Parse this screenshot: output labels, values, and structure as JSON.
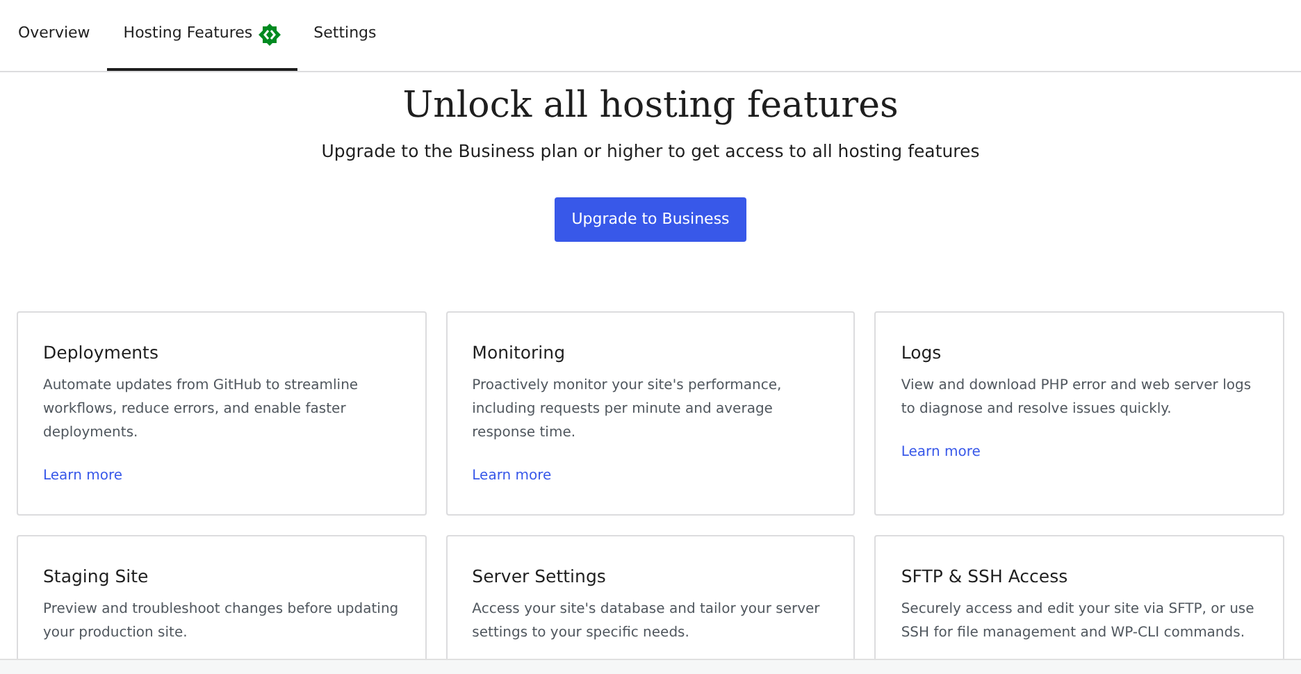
{
  "tabs": [
    {
      "label": "Overview",
      "selected": false,
      "badge": false
    },
    {
      "label": "Hosting Features",
      "selected": true,
      "badge": true
    },
    {
      "label": "Settings",
      "selected": false,
      "badge": false
    }
  ],
  "hero": {
    "title": "Unlock all hosting features",
    "subtitle": "Upgrade to the Business plan or higher to get access to all hosting features",
    "button": "Upgrade to Business"
  },
  "cards": [
    {
      "title": "Deployments",
      "description": "Automate updates from GitHub to streamline workflows, reduce errors, and enable faster deployments.",
      "link": "Learn more"
    },
    {
      "title": "Monitoring",
      "description": "Proactively monitor your site's performance, including requests per minute and average response time.",
      "link": "Learn more"
    },
    {
      "title": "Logs",
      "description": "View and download PHP error and web server logs to diagnose and resolve issues quickly.",
      "link": "Learn more"
    },
    {
      "title": "Staging Site",
      "description": "Preview and troubleshoot changes before updating your production site."
    },
    {
      "title": "Server Settings",
      "description": "Access your site's database and tailor your server settings to your specific needs."
    },
    {
      "title": "SFTP & SSH Access",
      "description": "Securely access and edit your site via SFTP, or use SSH for file management and WP-CLI commands."
    }
  ]
}
